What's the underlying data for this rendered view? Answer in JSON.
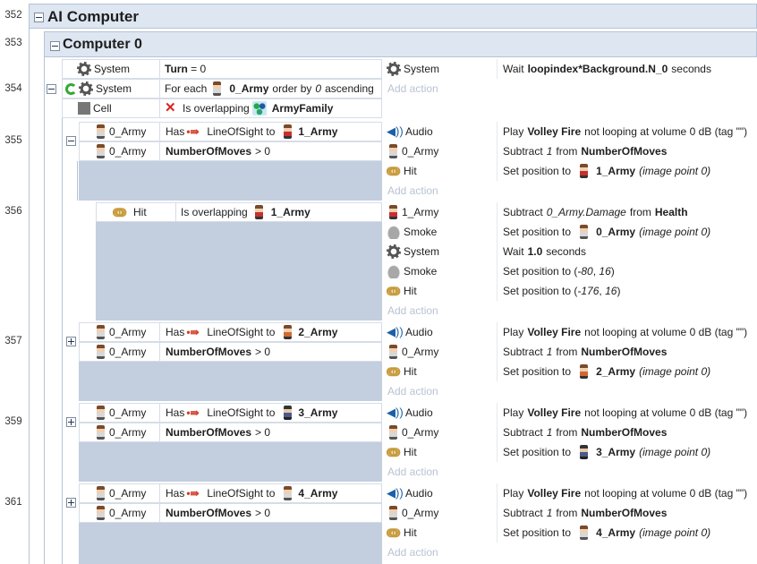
{
  "line_numbers": [
    "352",
    "353",
    "354",
    "355",
    "356",
    "357",
    "359",
    "361"
  ],
  "groups": {
    "ai_computer": {
      "title": "AI Computer"
    },
    "computer_0": {
      "title": "Computer 0"
    }
  },
  "event_354": {
    "conditions": [
      {
        "object": "System",
        "icon": "gear-icon",
        "text_bold": "Turn",
        "text_rest": " = 0"
      },
      {
        "object": "System",
        "icon": "gear-icon",
        "pre": "For each",
        "obj2": "0_Army",
        "mid": "order by",
        "val": "0",
        "post": "ascending"
      },
      {
        "object": "Cell",
        "icon": "cell-icon",
        "pre": "Is overlapping",
        "obj2": "ArmyFamily"
      }
    ],
    "actions": [
      {
        "object": "System",
        "icon": "gear-icon",
        "pre": "Wait",
        "bold": "loopindex*Background.N_0",
        "post": "seconds"
      }
    ],
    "add_action": "Add action"
  },
  "event_355": {
    "conditions": [
      {
        "object": "0_Army",
        "pre": "Has",
        "los": "LineOfSight to",
        "target": "1_Army"
      },
      {
        "object": "0_Army",
        "bold": "NumberOfMoves",
        "post": "> 0"
      }
    ],
    "actions": [
      {
        "object": "Audio",
        "pre": "Play",
        "bold": "Volley Fire",
        "post": "not looping at volume 0 dB (tag \"\")"
      },
      {
        "object": "0_Army",
        "pre": "Subtract",
        "ital": "1",
        "mid": "from",
        "bold": "NumberOfMoves"
      },
      {
        "object": "Hit",
        "pre": "Set position to",
        "target": "1_Army",
        "ital": "(image point 0)"
      }
    ],
    "add_action": "Add action"
  },
  "event_356": {
    "conditions": [
      {
        "object": "Hit",
        "pre": "Is overlapping",
        "target": "1_Army"
      }
    ],
    "actions": [
      {
        "object": "1_Army",
        "pre": "Subtract",
        "ital": "0_Army.Damage",
        "mid": "from",
        "bold": "Health"
      },
      {
        "object": "Smoke",
        "pre": "Set position to",
        "target": "0_Army",
        "ital": "(image point 0)"
      },
      {
        "object": "System",
        "pre": "Wait",
        "bold": "1.0",
        "post": "seconds"
      },
      {
        "object": "Smoke",
        "pre": "Set position to (",
        "ital": "-80",
        "mid": ",",
        "ital2": "16",
        "post": ")"
      },
      {
        "object": "Hit",
        "pre": "Set position to (",
        "ital": "-176",
        "mid": ",",
        "ital2": "16",
        "post": ")"
      }
    ],
    "add_action": "Add action"
  },
  "event_357": {
    "conditions": [
      {
        "object": "0_Army",
        "pre": "Has",
        "los": "LineOfSight to",
        "target": "2_Army"
      },
      {
        "object": "0_Army",
        "bold": "NumberOfMoves",
        "post": "> 0"
      }
    ],
    "actions": [
      {
        "object": "Audio",
        "pre": "Play",
        "bold": "Volley Fire",
        "post": "not looping at volume 0 dB (tag \"\")"
      },
      {
        "object": "0_Army",
        "pre": "Subtract",
        "ital": "1",
        "mid": "from",
        "bold": "NumberOfMoves"
      },
      {
        "object": "Hit",
        "pre": "Set position to",
        "target": "2_Army",
        "ital": "(image point 0)"
      }
    ],
    "add_action": "Add action"
  },
  "event_359": {
    "conditions": [
      {
        "object": "0_Army",
        "pre": "Has",
        "los": "LineOfSight to",
        "target": "3_Army"
      },
      {
        "object": "0_Army",
        "bold": "NumberOfMoves",
        "post": "> 0"
      }
    ],
    "actions": [
      {
        "object": "Audio",
        "pre": "Play",
        "bold": "Volley Fire",
        "post": "not looping at volume 0 dB (tag \"\")"
      },
      {
        "object": "0_Army",
        "pre": "Subtract",
        "ital": "1",
        "mid": "from",
        "bold": "NumberOfMoves"
      },
      {
        "object": "Hit",
        "pre": "Set position to",
        "target": "3_Army",
        "ital": "(image point 0)"
      }
    ],
    "add_action": "Add action"
  },
  "event_361": {
    "conditions": [
      {
        "object": "0_Army",
        "pre": "Has",
        "los": "LineOfSight to",
        "target": "4_Army"
      },
      {
        "object": "0_Army",
        "bold": "NumberOfMoves",
        "post": "> 0"
      }
    ],
    "actions": [
      {
        "object": "Audio",
        "pre": "Play",
        "bold": "Volley Fire",
        "post": "not looping at volume 0 dB (tag \"\")"
      },
      {
        "object": "0_Army",
        "pre": "Subtract",
        "ital": "1",
        "mid": "from",
        "bold": "NumberOfMoves"
      },
      {
        "object": "Hit",
        "pre": "Set position to",
        "target": "4_Army",
        "ital": "(image point 0)"
      }
    ],
    "add_action": "Add action"
  }
}
